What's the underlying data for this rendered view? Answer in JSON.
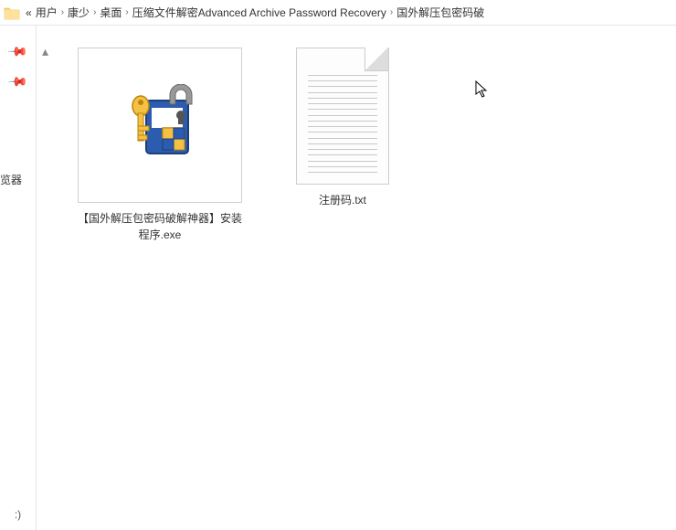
{
  "breadcrumb": {
    "overflow": "«",
    "items": [
      "用户",
      "康少",
      "桌面",
      "压缩文件解密Advanced Archive Password Recovery",
      "国外解压包密码破"
    ],
    "sep": "›"
  },
  "left_rail": {
    "hint_text": "览器",
    "bottom_text": ":)"
  },
  "files": [
    {
      "label": "【国外解压包密码破解神器】安装程序.exe",
      "type": "exe"
    },
    {
      "label": "注册码.txt",
      "type": "txt"
    }
  ]
}
